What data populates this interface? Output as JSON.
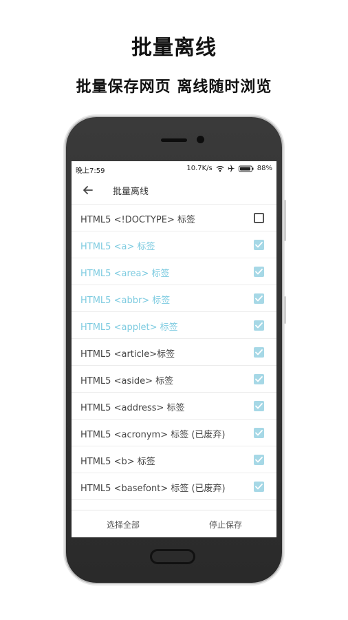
{
  "promo": {
    "title": "批量离线",
    "subtitle": "批量保存网页  离线随时浏览"
  },
  "status_bar": {
    "time": "晚上7:59",
    "speed": "10.7K/s",
    "battery": "88%",
    "icons": [
      "wifi-icon",
      "airplane-icon",
      "battery-icon"
    ]
  },
  "app_bar": {
    "back_icon": "arrow-left-icon",
    "title": "批量离线"
  },
  "items": [
    {
      "label": "HTML5 <!DOCTYPE> 标签",
      "checked": false,
      "highlighted": false
    },
    {
      "label": "HTML5 <a> 标签",
      "checked": true,
      "highlighted": true
    },
    {
      "label": "HTML5 <area> 标签",
      "checked": true,
      "highlighted": true
    },
    {
      "label": "HTML5 <abbr> 标签",
      "checked": true,
      "highlighted": true
    },
    {
      "label": "HTML5 <applet> 标签",
      "checked": true,
      "highlighted": true
    },
    {
      "label": "HTML5 <article>标签",
      "checked": true,
      "highlighted": false
    },
    {
      "label": "HTML5 <aside> 标签",
      "checked": true,
      "highlighted": false
    },
    {
      "label": "HTML5 <address> 标签",
      "checked": true,
      "highlighted": false
    },
    {
      "label": "HTML5 <acronym> 标签 (已废弃)",
      "checked": true,
      "highlighted": false
    },
    {
      "label": "HTML5 <b> 标签",
      "checked": true,
      "highlighted": false
    },
    {
      "label": "HTML5 <basefont> 标签 (已废弃)",
      "checked": true,
      "highlighted": false
    }
  ],
  "bottom_bar": {
    "select_all": "选择全部",
    "stop_save": "停止保存"
  },
  "colors": {
    "highlight_text": "#7dcbe0",
    "checkbox_on": "#a6d8e6",
    "phone_body": "#2f2f2f"
  }
}
